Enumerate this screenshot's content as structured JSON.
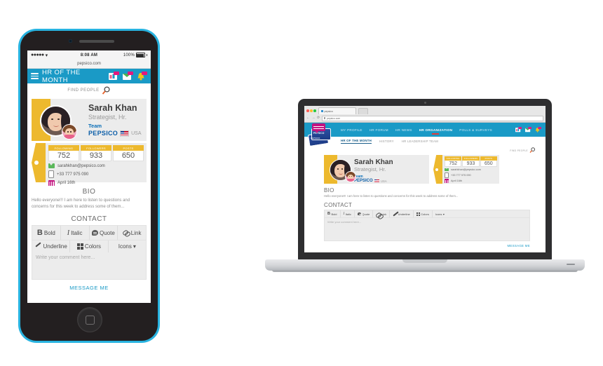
{
  "phone": {
    "status": {
      "signal": "●●●●●",
      "wifi": "◂",
      "time": "8:08 AM",
      "battery": "100%"
    },
    "url": "pepsico.com",
    "app_title": "HR OF THE MONTH",
    "find_people": "FIND PEOPLE",
    "profile": {
      "name": "Sarah Khan",
      "role": "Strategist, Hr.",
      "team_label": "Team",
      "brand": "PEPSICO",
      "country": "USA"
    },
    "stats": [
      {
        "label": "FOLLOWING",
        "value": "752"
      },
      {
        "label": "FOLLOWERS",
        "value": "933"
      },
      {
        "label": "POSTS",
        "value": "650"
      }
    ],
    "contact": [
      {
        "icon": "mail-icon",
        "text": "sarahkhan@pepsico.com"
      },
      {
        "icon": "phone-icon",
        "text": "+33 777 975 090"
      },
      {
        "icon": "calendar-icon",
        "text": "April 16th"
      }
    ],
    "bio_heading": "BIO",
    "bio_text": "Hello everyone!!! I am here to listen to questions and concerns for this week to address some of them...",
    "contact_heading": "CONTACT",
    "toolbar_row1": [
      "Bold",
      "Italic",
      "Quote",
      "Link"
    ],
    "toolbar_row2": [
      "Underline",
      "Colors",
      "Icons"
    ],
    "icons_caret": "▾",
    "comment_placeholder": "Write your comment here...",
    "message_me": "MESSAGE ME"
  },
  "laptop": {
    "browser": {
      "tab_title": "pepsico",
      "address": "pepsico.com",
      "back": "←",
      "forward": "→",
      "reload": "⟳"
    },
    "logo": {
      "line1": "PEPSICO",
      "line2": "PEPSICO"
    },
    "nav": [
      {
        "label": "MY PROFILE",
        "active": false
      },
      {
        "label": "HR FORUM",
        "active": false
      },
      {
        "label": "HR NEWS",
        "active": false
      },
      {
        "label": "HR ORGANIZATION",
        "active": true
      },
      {
        "label": "POLLS & SURVEYS",
        "active": false
      }
    ],
    "subnav": [
      {
        "label": "HR OF THE MONTH",
        "active": true
      },
      {
        "label": "HISTORY",
        "active": false
      },
      {
        "label": "HR LEADERSHIP TEAM",
        "active": false
      }
    ],
    "find_people": "FIND PEOPLE",
    "profile": {
      "name": "Sarah Khan",
      "role": "Strategist, Hr.",
      "team_label": "Team",
      "brand": "PEPSICO",
      "country": "USA"
    },
    "stats": [
      {
        "label": "FOLLOWING",
        "value": "752"
      },
      {
        "label": "FOLLOWERS",
        "value": "933"
      },
      {
        "label": "POSTS",
        "value": "650"
      }
    ],
    "contact": [
      {
        "icon": "mail-icon",
        "text": "sarahkhan@pepsico.com"
      },
      {
        "icon": "phone-icon",
        "text": "+33 777 975 090"
      },
      {
        "icon": "calendar-icon",
        "text": "April 16th"
      }
    ],
    "bio_heading": "BIO",
    "bio_text": "Hello everyone!!! I am here to listen to questions and concerns for this week to address some of them...",
    "contact_heading": "CONTACT",
    "toolbar": [
      "Bold",
      "Italic",
      "Quote",
      "Link",
      "Underline",
      "Colors",
      "Icons"
    ],
    "icons_caret": "▾",
    "comment_placeholder": "Write your comment here...",
    "message_me": "MESSAGE ME"
  },
  "colors": {
    "brand_blue": "#1a9ac6",
    "accent_yellow": "#edb92e",
    "pepsi_blue": "#0b5ea8",
    "phone_bezel": "#28b3e0",
    "magenta": "#c2127f",
    "green": "#5bb85b"
  }
}
